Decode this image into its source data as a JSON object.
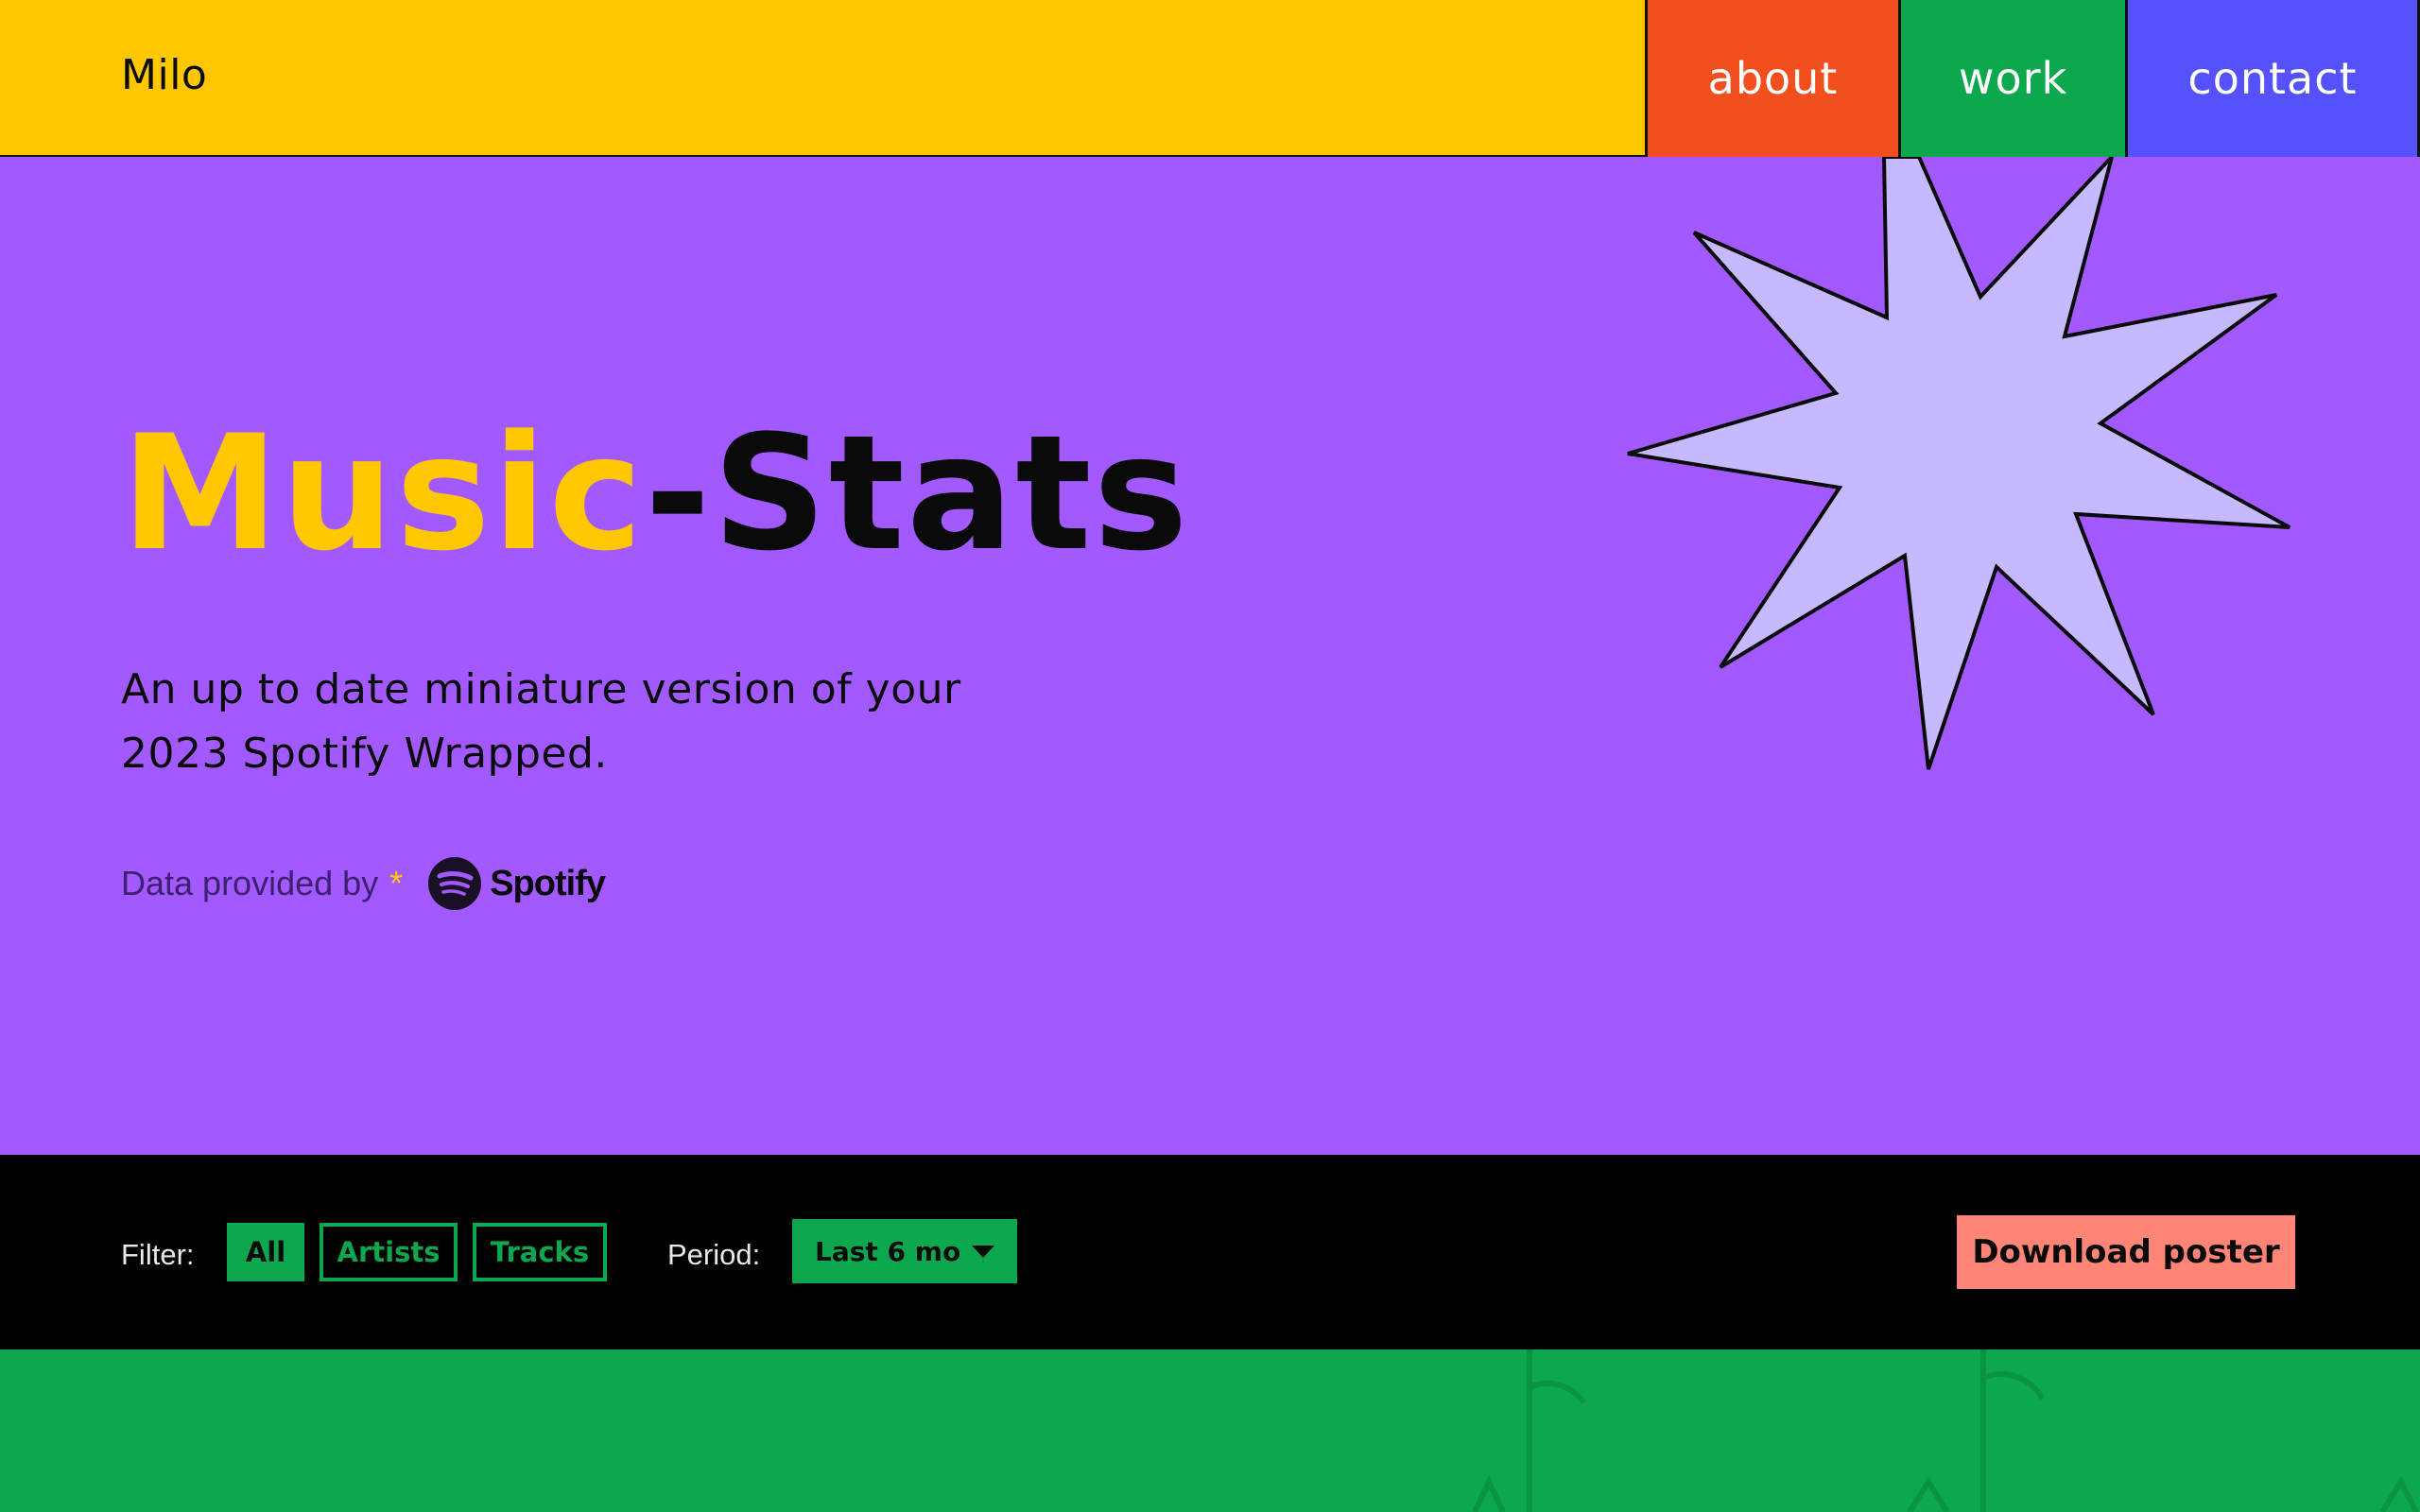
{
  "header": {
    "brand": "Milo",
    "nav": {
      "about": "about",
      "work": "work",
      "contact": "contact"
    }
  },
  "hero": {
    "title_highlight": "Music",
    "title_rest": "-Stats",
    "subtitle": "An up to date miniature version of your 2023 Spotify Wrapped.",
    "credit_prefix": "Data provided by",
    "credit_asterisk": "*",
    "spotify_wordmark": "Spotify"
  },
  "filterbar": {
    "filter_label": "Filter:",
    "chips": {
      "all": "All",
      "artists": "Artists",
      "tracks": "Tracks"
    },
    "selected_chip": "All",
    "period_label": "Period:",
    "period_value": "Last 6 mo",
    "download_label": "Download poster"
  },
  "colors": {
    "header_bg": "#FFC700",
    "about_tab": "#F24E1E",
    "work_tab": "#0DA84E",
    "contact_tab": "#5551FF",
    "hero_bg": "#A259FF",
    "starburst_fill": "#C7B9FF",
    "filterbar_bg": "#000000",
    "accent_green": "#0DA84E",
    "download_button": "#FF8577"
  },
  "icons": {
    "spotify": "spotify-logo-icon",
    "dropdown": "caret-down-icon",
    "decoration": "starburst-icon"
  }
}
